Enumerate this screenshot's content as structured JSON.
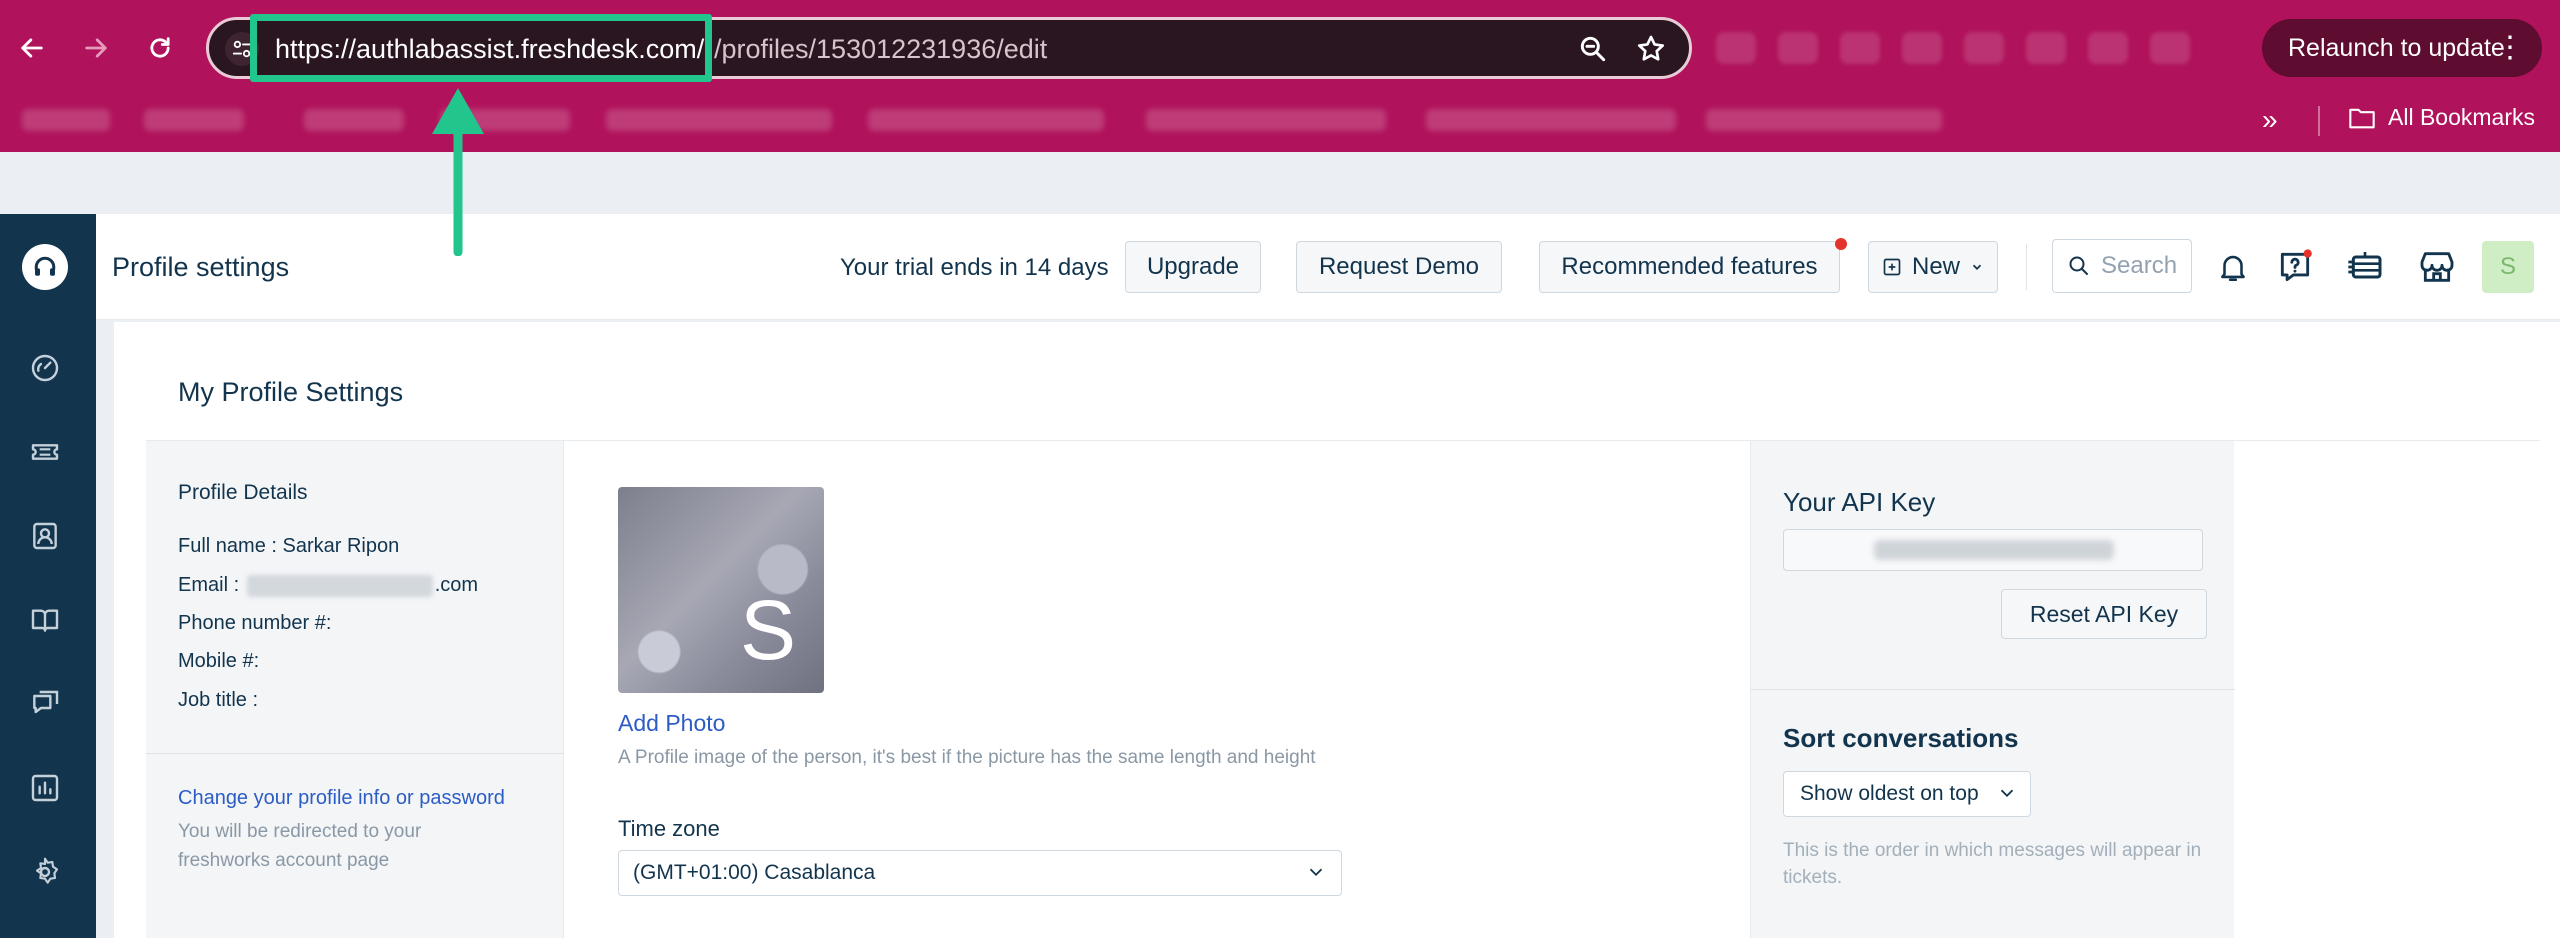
{
  "browser": {
    "url_host": "https://authlabassist.freshdesk.com/",
    "url_path": "/profiles/153012231936/edit",
    "relaunch_label": "Relaunch to update",
    "all_bookmarks_label": "All Bookmarks",
    "theme_color": "#b0125b",
    "highlight_color": "#22c58b"
  },
  "header": {
    "page_title": "Profile settings",
    "trial_text": "Your trial ends in 14 days",
    "upgrade_label": "Upgrade",
    "request_demo_label": "Request Demo",
    "recommended_label": "Recommended features",
    "new_label": "New",
    "search_placeholder": "Search",
    "avatar_initial": "S"
  },
  "sidebar": {
    "items": [
      {
        "icon": "dashboard-icon"
      },
      {
        "icon": "tickets-icon"
      },
      {
        "icon": "contacts-icon"
      },
      {
        "icon": "solutions-icon"
      },
      {
        "icon": "forums-icon"
      },
      {
        "icon": "reports-icon"
      },
      {
        "icon": "admin-gear-icon"
      }
    ]
  },
  "main": {
    "section_title": "My Profile Settings",
    "profile_details": {
      "title": "Profile Details",
      "full_name_label": "Full name :",
      "full_name_value": "Sarkar Ripon",
      "email_label": "Email :",
      "email_suffix": ".com",
      "phone_label": "Phone number #:",
      "mobile_label": "Mobile #:",
      "job_title_label": "Job title :",
      "change_link": "Change your profile info or password",
      "redirect_note": "You will be redirected to your freshworks account page"
    },
    "photo": {
      "initial": "S",
      "add_photo_label": "Add Photo",
      "hint": "A Profile image of the person, it's best if the picture has the same length and height"
    },
    "time_zone": {
      "label": "Time zone",
      "value": "(GMT+01:00) Casablanca"
    },
    "api": {
      "title": "Your API Key",
      "reset_label": "Reset API Key"
    },
    "sort": {
      "title": "Sort conversations",
      "value": "Show oldest on top",
      "hint": "This is the order in which messages will appear in tickets."
    }
  }
}
